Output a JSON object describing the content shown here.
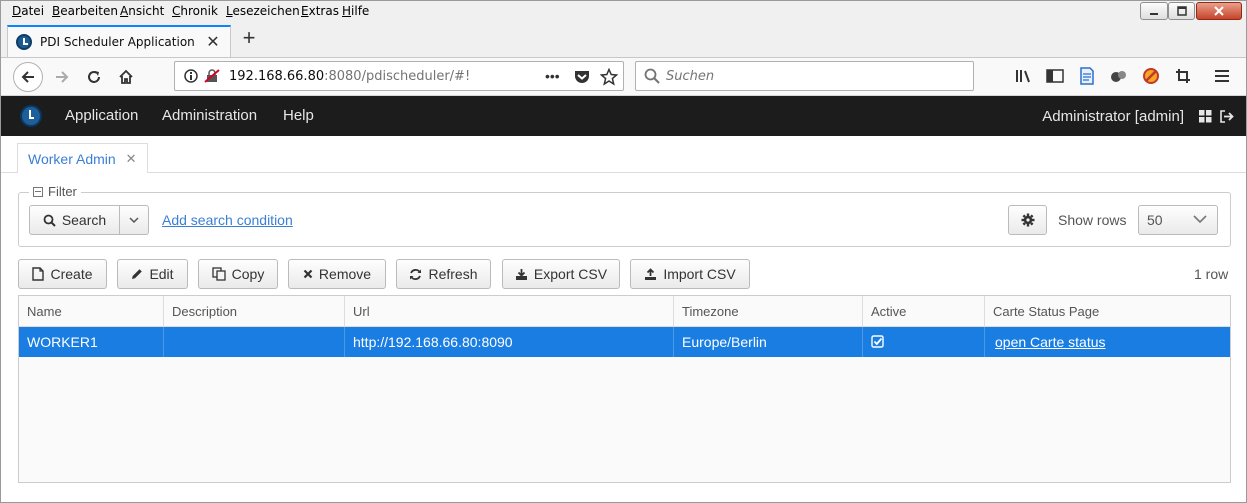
{
  "menubar": {
    "items": [
      "Datei",
      "Bearbeiten",
      "Ansicht",
      "Chronik",
      "Lesezeichen",
      "Extras",
      "Hilfe"
    ]
  },
  "browser": {
    "tab_title": "PDI Scheduler Application",
    "url_host": "192.168.66.80",
    "url_rest": ":8080/pdischeduler/#!",
    "search_placeholder": "Suchen"
  },
  "app": {
    "menu": [
      "Application",
      "Administration",
      "Help"
    ],
    "user": "Administrator [admin]"
  },
  "tabs": [
    {
      "label": "Worker Admin"
    }
  ],
  "filter": {
    "legend": "Filter",
    "search_label": "Search",
    "add_condition": "Add search condition",
    "show_rows_label": "Show rows",
    "show_rows_value": "50"
  },
  "toolbar": {
    "create": "Create",
    "edit": "Edit",
    "copy": "Copy",
    "remove": "Remove",
    "refresh": "Refresh",
    "export_csv": "Export CSV",
    "import_csv": "Import CSV",
    "row_count": "1 row"
  },
  "table": {
    "columns": [
      "Name",
      "Description",
      "Url",
      "Timezone",
      "Active",
      "Carte Status Page"
    ],
    "rows": [
      {
        "name": "WORKER1",
        "description": "",
        "url": "http://192.168.66.80:8090",
        "timezone": "Europe/Berlin",
        "active": true,
        "status_link": "open Carte status"
      }
    ]
  },
  "colors": {
    "accent": "#197de1",
    "link": "#3a7fd5",
    "header_bg": "#1c1c1c"
  }
}
